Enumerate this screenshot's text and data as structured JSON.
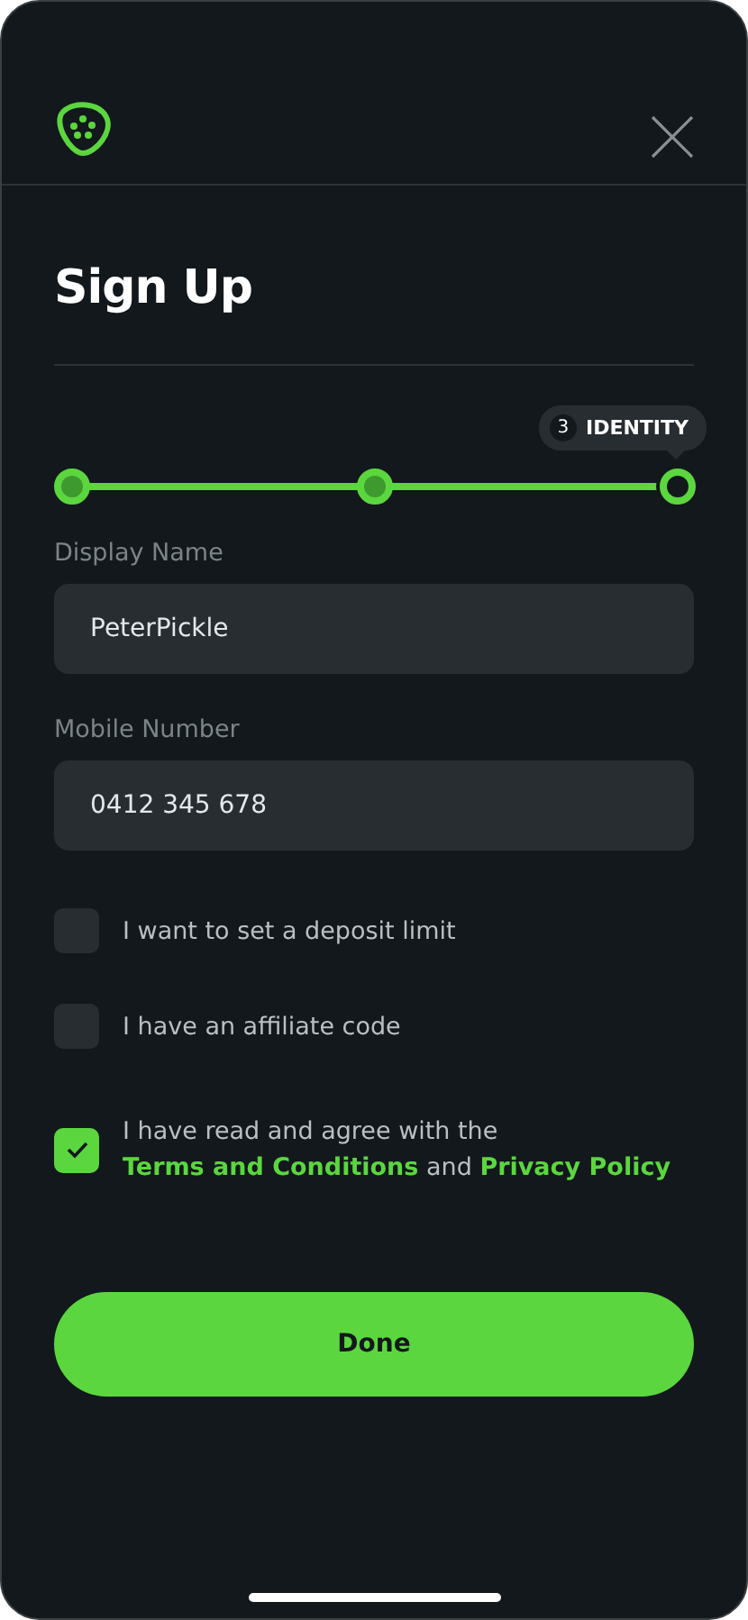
{
  "header": {
    "title": "Sign Up"
  },
  "progress": {
    "steps": [
      {
        "completed": true,
        "selected": false
      },
      {
        "completed": true,
        "selected": false
      },
      {
        "completed": false,
        "selected": true
      }
    ],
    "badge": {
      "number": "3",
      "label": "IDENTITY"
    }
  },
  "fields": [
    {
      "label": "Display Name",
      "value": "PeterPickle"
    },
    {
      "label": "Mobile Number",
      "value": "0412 345 678"
    }
  ],
  "options": [
    {
      "kind": "plain",
      "label": "I want to set a deposit limit",
      "checked": false
    },
    {
      "kind": "plain",
      "label": "I have an affiliate code",
      "checked": false
    },
    {
      "kind": "agreement",
      "label": "I have read and agree with the",
      "links": [
        "Terms and Conditions",
        "Privacy Policy"
      ],
      "joiner": "and",
      "checked": true
    }
  ],
  "button": {
    "label": "Done"
  }
}
